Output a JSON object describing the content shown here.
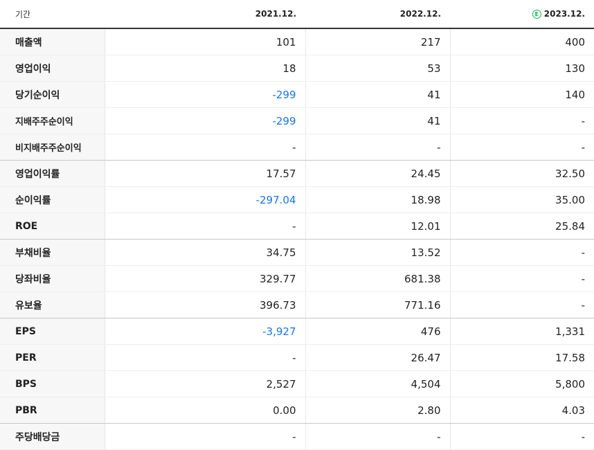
{
  "header": {
    "label": "기간",
    "years": [
      {
        "label": "2021.12.",
        "estimate": false
      },
      {
        "label": "2022.12.",
        "estimate": false
      },
      {
        "label": "2023.12.",
        "estimate": true,
        "estimate_mark": "E"
      }
    ]
  },
  "colors": {
    "negative": "#1a73e8",
    "estimate_badge": "#19b35a",
    "label_bg": "#f7f7f7"
  },
  "rows": [
    {
      "label": "매출액",
      "values": [
        "101",
        "217",
        "400"
      ]
    },
    {
      "label": "영업이익",
      "values": [
        "18",
        "53",
        "130"
      ]
    },
    {
      "label": "당기순이익",
      "values": [
        "-299",
        "41",
        "140"
      ]
    },
    {
      "label": "지배주주순이익",
      "values": [
        "-299",
        "41",
        "-"
      ]
    },
    {
      "label": "비지배주주순이익",
      "values": [
        "-",
        "-",
        "-"
      ]
    },
    {
      "label": "영업이익률",
      "values": [
        "17.57",
        "24.45",
        "32.50"
      ]
    },
    {
      "label": "순이익률",
      "values": [
        "-297.04",
        "18.98",
        "35.00"
      ]
    },
    {
      "label": "ROE",
      "values": [
        "-",
        "12.01",
        "25.84"
      ]
    },
    {
      "label": "부채비율",
      "values": [
        "34.75",
        "13.52",
        "-"
      ]
    },
    {
      "label": "당좌비율",
      "values": [
        "329.77",
        "681.38",
        "-"
      ]
    },
    {
      "label": "유보율",
      "values": [
        "396.73",
        "771.16",
        "-"
      ]
    },
    {
      "label": "EPS",
      "values": [
        "-3,927",
        "476",
        "1,331"
      ]
    },
    {
      "label": "PER",
      "values": [
        "-",
        "26.47",
        "17.58"
      ]
    },
    {
      "label": "BPS",
      "values": [
        "2,527",
        "4,504",
        "5,800"
      ]
    },
    {
      "label": "PBR",
      "values": [
        "0.00",
        "2.80",
        "4.03"
      ]
    },
    {
      "label": "주당배당금",
      "values": [
        "-",
        "-",
        "-"
      ]
    }
  ]
}
